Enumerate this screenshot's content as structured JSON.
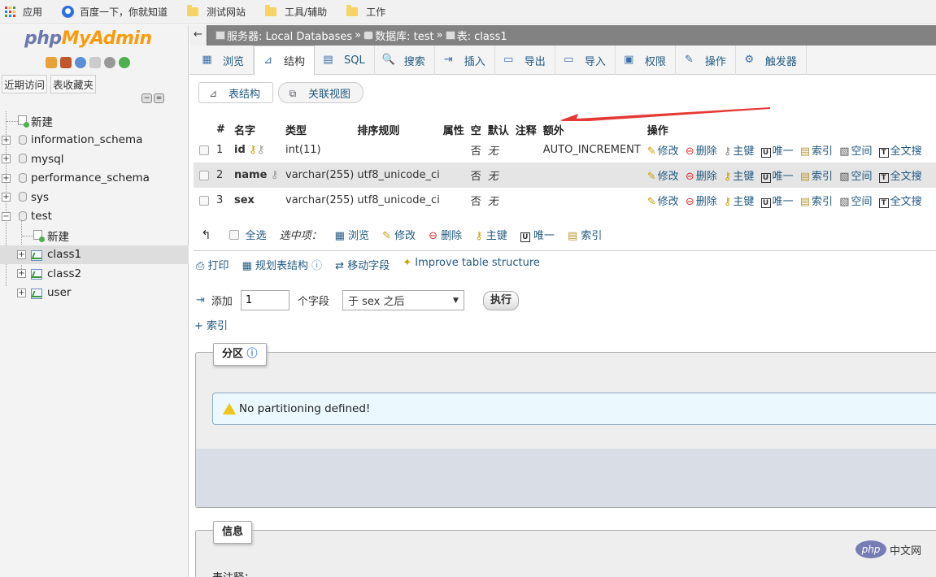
{
  "bookmarks": [
    {
      "label": "应用",
      "icon": "apps-grid-icon"
    },
    {
      "label": "百度一下，你就知道",
      "icon": "baidu-paw-icon"
    },
    {
      "label": "测试网站",
      "icon": "folder-icon"
    },
    {
      "label": "工具/辅助",
      "icon": "folder-icon"
    },
    {
      "label": "工作",
      "icon": "folder-icon"
    }
  ],
  "sidebar": {
    "logo_a": "php",
    "logo_b": "MyAdmin",
    "tabs": [
      "近期访问",
      "表收藏夹"
    ],
    "tree": [
      {
        "label": "新建",
        "type": "new"
      },
      {
        "label": "information_schema",
        "type": "db"
      },
      {
        "label": "mysql",
        "type": "db"
      },
      {
        "label": "performance_schema",
        "type": "db"
      },
      {
        "label": "sys",
        "type": "db"
      },
      {
        "label": "test",
        "type": "db-open"
      },
      {
        "label": "新建",
        "type": "new-child"
      },
      {
        "label": "class1",
        "type": "table",
        "selected": true
      },
      {
        "label": "class2",
        "type": "table"
      },
      {
        "label": "user",
        "type": "table"
      }
    ]
  },
  "breadcrumb": {
    "server": "服务器: Local Databases",
    "database": "数据库: test",
    "table": "表: class1",
    "sep": "»"
  },
  "tabs": [
    {
      "label": "浏览",
      "icon": "▦"
    },
    {
      "label": "结构",
      "icon": "⊿",
      "active": true
    },
    {
      "label": "SQL",
      "icon": "▤"
    },
    {
      "label": "搜索",
      "icon": "🔍"
    },
    {
      "label": "插入",
      "icon": "⇥"
    },
    {
      "label": "导出",
      "icon": "▭"
    },
    {
      "label": "导入",
      "icon": "▭"
    },
    {
      "label": "权限",
      "icon": "▣"
    },
    {
      "label": "操作",
      "icon": "✎"
    },
    {
      "label": "触发器",
      "icon": "⚙"
    }
  ],
  "subtabs": [
    "表结构",
    "关联视图"
  ],
  "table": {
    "headers": [
      "#",
      "名字",
      "类型",
      "排序规则",
      "属性",
      "空",
      "默认",
      "注释",
      "额外",
      "操作"
    ],
    "rows": [
      {
        "num": "1",
        "name": "id",
        "type": "int(11)",
        "collation": "",
        "attrs": "",
        "null": "否",
        "default": "无",
        "comment": "",
        "extra": "AUTO_INCREMENT"
      },
      {
        "num": "2",
        "name": "name",
        "type": "varchar(255)",
        "collation": "utf8_unicode_ci",
        "attrs": "",
        "null": "否",
        "default": "无",
        "comment": "",
        "extra": ""
      },
      {
        "num": "3",
        "name": "sex",
        "type": "varchar(255)",
        "collation": "utf8_unicode_ci",
        "attrs": "",
        "null": "否",
        "default": "无",
        "comment": "",
        "extra": ""
      }
    ],
    "row_actions": [
      "修改",
      "删除",
      "主键",
      "唯一",
      "索引",
      "空间",
      "全文搜"
    ]
  },
  "bulk": {
    "select_all": "全选",
    "with_selected": "选中项：",
    "actions": [
      "浏览",
      "修改",
      "删除",
      "主键",
      "唯一",
      "索引"
    ]
  },
  "tools": [
    "打印",
    "规划表结构",
    "移动字段",
    "Improve table structure"
  ],
  "add_field": {
    "label": "添加",
    "count": "1",
    "unit": "个字段",
    "position": "于 sex 之后",
    "execute": "执行",
    "add_index": "+ 索引"
  },
  "partition": {
    "legend": "分区",
    "message": "No partitioning defined!"
  },
  "info": {
    "legend": "信息",
    "comment_label": "表注释："
  },
  "watermark": {
    "badge": "php",
    "text": "中文网"
  },
  "colors": {
    "link": "#235a81",
    "header_bar": "#828282",
    "logo_php": "#6c78af",
    "logo_myadmin": "#f89c0e",
    "notice_bg": "#ebf8fd"
  }
}
